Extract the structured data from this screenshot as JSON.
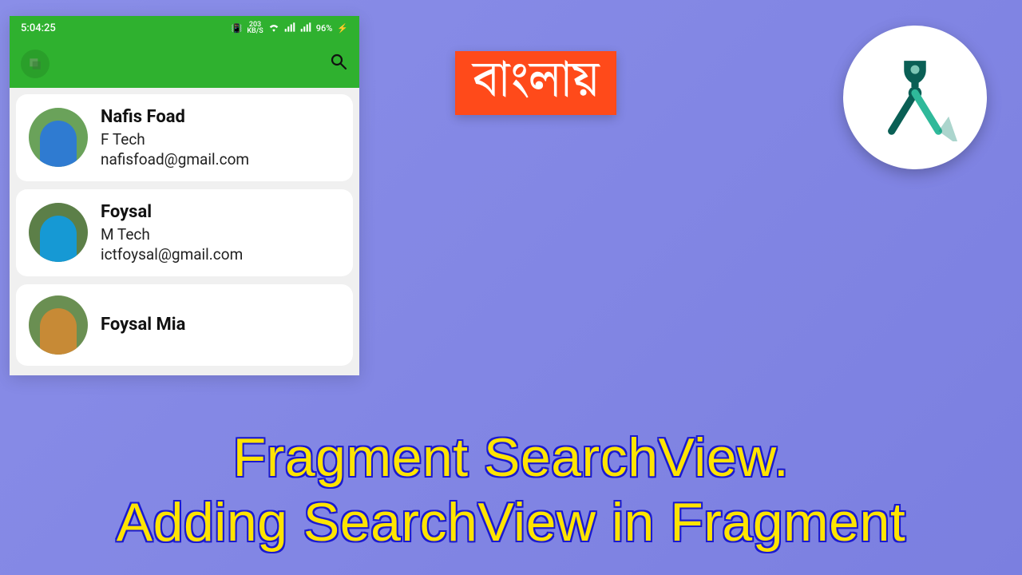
{
  "phone": {
    "status": {
      "time": "5:04:25",
      "net_speed_top": "203",
      "net_speed_bottom": "KB/S",
      "battery": "96%",
      "charging_glyph": "⚡"
    },
    "toolbar": {
      "nav_icon": "menu-icon",
      "search_icon": "search-icon"
    },
    "contacts": [
      {
        "name": "Nafis Foad",
        "subtitle": "F Tech",
        "email": "nafisfoad@gmail.com",
        "avatar_bg": "#6aa25a",
        "shirt": "#2f7bd1"
      },
      {
        "name": "Foysal",
        "subtitle": "M Tech",
        "email": "ictfoysal@gmail.com",
        "avatar_bg": "#5c7f48",
        "shirt": "#1699d4"
      },
      {
        "name": "Foysal Mia",
        "subtitle": "",
        "email": "",
        "avatar_bg": "#6a8f52",
        "shirt": "#c78a36"
      }
    ]
  },
  "banner": {
    "text": "বাংলায়"
  },
  "headline": {
    "line1": "Fragment SearchView.",
    "line2": "Adding SearchView in Fragment"
  },
  "logo": {
    "name": "android-studio-logo"
  }
}
